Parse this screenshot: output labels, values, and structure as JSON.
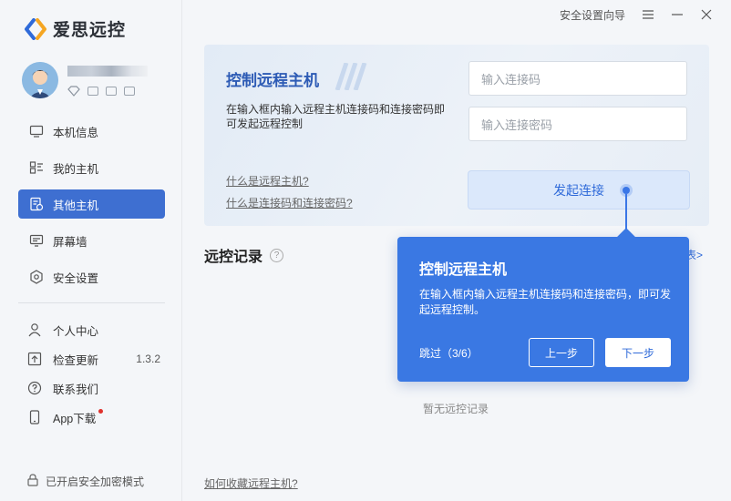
{
  "app": {
    "name": "爱思远控"
  },
  "topbar": {
    "guide": "安全设置向导"
  },
  "sidebar": {
    "nav": [
      {
        "label": "本机信息",
        "icon": "monitor-icon"
      },
      {
        "label": "我的主机",
        "icon": "host-list-icon"
      },
      {
        "label": "其他主机",
        "icon": "other-host-icon"
      },
      {
        "label": "屏幕墙",
        "icon": "screen-wall-icon"
      },
      {
        "label": "安全设置",
        "icon": "shield-icon"
      }
    ],
    "nav2": [
      {
        "label": "个人中心",
        "icon": "user-icon"
      },
      {
        "label": "检查更新",
        "icon": "update-icon",
        "version": "1.3.2"
      },
      {
        "label": "联系我们",
        "icon": "help-icon"
      },
      {
        "label": "App下载",
        "icon": "phone-icon"
      }
    ],
    "secure_mode": "已开启安全加密模式"
  },
  "card": {
    "title": "控制远程主机",
    "desc": "在输入框内输入远程主机连接码和连接密码即可发起远程控制",
    "link1": "什么是远程主机?",
    "link2": "什么是连接码和连接密码?",
    "code_placeholder": "输入连接码",
    "password_placeholder": "输入连接密码",
    "connect": "发起连接"
  },
  "records": {
    "title": "远控记录",
    "help": "?",
    "table_link": "表>",
    "empty": "暂无远控记录",
    "bottom_link": "如何收藏远程主机?"
  },
  "tooltip": {
    "title": "控制远程主机",
    "body": "在输入框内输入远程主机连接码和连接密码，即可发起远程控制。",
    "skip": "跳过（3/6）",
    "prev": "上一步",
    "next": "下一步"
  },
  "colors": {
    "accent": "#3e6fd1",
    "tooltip": "#3a78e3",
    "link": "#2f6ad9"
  }
}
